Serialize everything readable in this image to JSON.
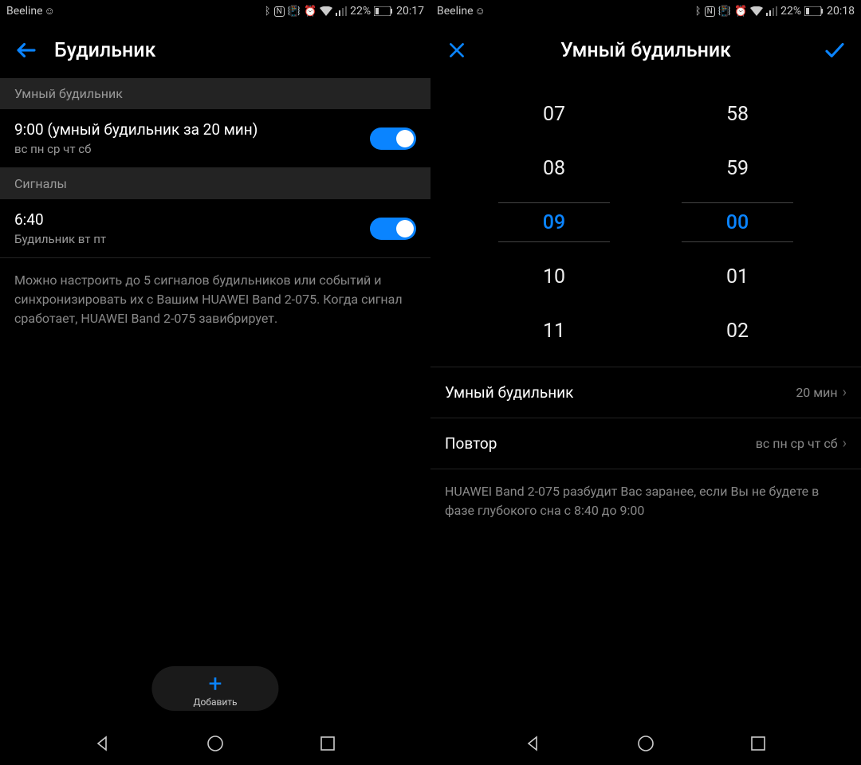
{
  "left": {
    "status": {
      "carrier": "Beeline",
      "battery": "22%",
      "time": "20:17"
    },
    "title": "Будильник",
    "section_smart": "Умный будильник",
    "smart_alarm": {
      "title": "9:00 (умный будильник за 20 мин)",
      "sub": "вс пн ср чт сб",
      "on": true
    },
    "section_signals": "Сигналы",
    "signal": {
      "title": "6:40",
      "sub": "Будильник  вт пт",
      "on": true
    },
    "info": "Можно настроить до 5 сигналов будильников или событий и синхронизировать их с Вашим HUAWEI Band 2-075. Когда сигнал сработает, HUAWEI Band 2-075 завибрирует.",
    "add_label": "Добавить"
  },
  "right": {
    "status": {
      "carrier": "Beeline",
      "battery": "22%",
      "time": "20:18"
    },
    "title": "Умный будильник",
    "hours": [
      "07",
      "08",
      "09",
      "10",
      "11"
    ],
    "minutes": [
      "58",
      "59",
      "00",
      "01",
      "02"
    ],
    "selected_h": "09",
    "selected_m": "00",
    "smart_label": "Умный будильник",
    "smart_value": "20  мин",
    "repeat_label": "Повтор",
    "repeat_value": "вс пн ср чт сб",
    "info": "HUAWEI Band 2-075 разбудит Вас заранее, если Вы не будете в фазе глубокого сна с 8:40 до 9:00"
  }
}
